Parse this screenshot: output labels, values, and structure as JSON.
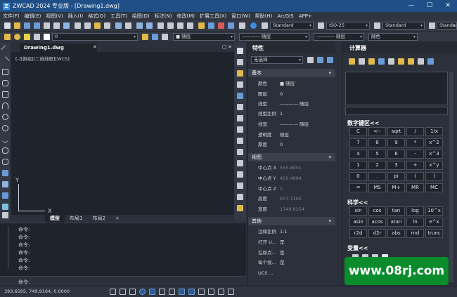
{
  "window": {
    "title": "ZWCAD 2024 专业版 - [Drawing1.dwg]",
    "logo": "Z"
  },
  "menu": [
    "文件(F)",
    "编辑(E)",
    "视图(V)",
    "插入(I)",
    "格式(O)",
    "工具(T)",
    "绘图(D)",
    "标注(N)",
    "修改(M)",
    "扩展工具(X)",
    "窗口(W)",
    "帮助(H)",
    "ArcGIS",
    "APP+"
  ],
  "toolbar": {
    "text_style": "Standard",
    "dim_style": "ISO-25",
    "table_style": "Standard",
    "multileader_style": "Standard",
    "layer": "0",
    "color": "■ 随层",
    "linetype": "———— 随层",
    "lineweight": "———— 随层",
    "plotstyle": "随色"
  },
  "document": {
    "tab": "Drawing1.dwg",
    "view_label": "[-][俯视][二维线框][WCS]",
    "ucs_x": "X",
    "ucs_y": "Y"
  },
  "layouts": [
    "模型",
    "布局1",
    "布局2",
    "+"
  ],
  "command": {
    "lines": [
      "命令:",
      "命令:",
      "命令:",
      "命令:",
      "命令:",
      "命令:"
    ],
    "prompt": "命令:"
  },
  "status": {
    "coords": "393.6595, 749.9164, 0.0000"
  },
  "properties": {
    "title": "特性",
    "selection": "无选择",
    "sections": {
      "basic": "基本",
      "view": "视图",
      "other": "其他"
    },
    "basic": [
      {
        "k": "颜色",
        "v": "■ 随层"
      },
      {
        "k": "图层",
        "v": "0"
      },
      {
        "k": "线型",
        "v": "———— 随层"
      },
      {
        "k": "线型比例",
        "v": "1"
      },
      {
        "k": "线宽",
        "v": "———— 随层"
      },
      {
        "k": "透明度",
        "v": "随层"
      },
      {
        "k": "厚度",
        "v": "0"
      }
    ],
    "view": [
      {
        "k": "中心点 X",
        "v": "555.8901"
      },
      {
        "k": "中心点 Y",
        "v": "450.4994"
      },
      {
        "k": "中心点 Z",
        "v": "0"
      },
      {
        "k": "高度",
        "v": "607.7385"
      },
      {
        "k": "宽度",
        "v": "1749.6254"
      }
    ],
    "other": [
      {
        "k": "注释比例",
        "v": "1:1"
      },
      {
        "k": "打开 U...",
        "v": "是"
      },
      {
        "k": "在原点...",
        "v": "是"
      },
      {
        "k": "每个视...",
        "v": "是"
      },
      {
        "k": "UCS ...",
        "v": ""
      }
    ]
  },
  "calculator": {
    "title": "计算器",
    "keypad_title": "数字键区<<",
    "keypad": [
      "C",
      "<--",
      "sqrt",
      "/",
      "1/x",
      "7",
      "8",
      "9",
      "*",
      "x^2",
      "4",
      "5",
      "6",
      "-",
      "x^3",
      "1",
      "2",
      "3",
      "+",
      "x^y",
      "0",
      ".",
      "pi",
      "(",
      ")",
      "=",
      "MS",
      "M+",
      "MR",
      "MC"
    ],
    "sci_title": "科学<<",
    "sci": [
      "sin",
      "cos",
      "tan",
      "log",
      "10^x",
      "asin",
      "acos",
      "atan",
      "ln",
      "e^x",
      "r2d",
      "d2r",
      "abs",
      "rnd",
      "trunc"
    ],
    "var_title": "变量<<"
  },
  "watermark": "www.08rj.com",
  "colors": {
    "titlebar": "#1f4f86",
    "panel": "#2b303a",
    "drawing": "#1f232b",
    "watermark": "#0a8c2c"
  }
}
